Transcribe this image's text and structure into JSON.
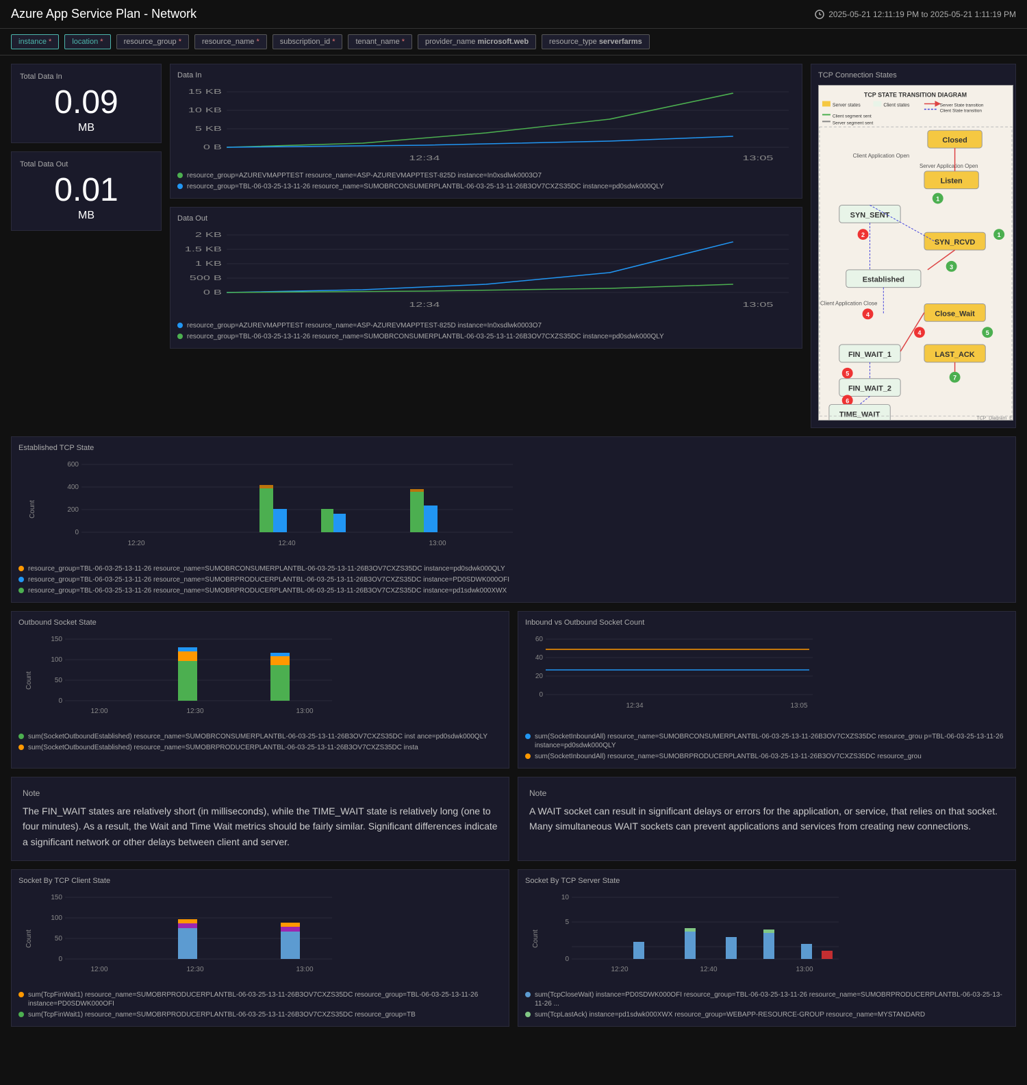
{
  "header": {
    "title": "Azure App Service Plan - Network",
    "time_range": "2025-05-21 12:11:19 PM to 2025-05-21 1:11:19 PM"
  },
  "filters": [
    {
      "id": "instance",
      "label": "instance",
      "required": true,
      "active": true
    },
    {
      "id": "location",
      "label": "location",
      "required": true,
      "active": true
    },
    {
      "id": "resource_group",
      "label": "resource_group",
      "required": true,
      "active": false
    },
    {
      "id": "resource_name",
      "label": "resource_name",
      "required": true,
      "active": false
    },
    {
      "id": "subscription_id",
      "label": "subscription_id",
      "required": true,
      "active": false
    },
    {
      "id": "tenant_name",
      "label": "tenant_name",
      "required": true,
      "active": false
    },
    {
      "id": "provider_name",
      "label": "provider_name microsoft.web",
      "required": false,
      "active": false
    },
    {
      "id": "resource_type",
      "label": "resource_type serverfarms",
      "required": false,
      "active": false
    }
  ],
  "metrics": {
    "total_data_in": {
      "label": "Total Data In",
      "value": "0.09",
      "unit": "MB"
    },
    "total_data_out": {
      "label": "Total Data Out",
      "value": "0.01",
      "unit": "MB"
    }
  },
  "charts": {
    "data_in": {
      "title": "Data In",
      "y_labels": [
        "15 KB",
        "10 KB",
        "5 KB",
        "0 B"
      ],
      "x_labels": [
        "12:34",
        "13:05"
      ],
      "legend": [
        {
          "color": "#4caf50",
          "text": "resource_group=AZUREVMAPPTEST resource_name=ASP-AZUREVMAPPTEST-825D instance=In0xsdlwk0003O7"
        },
        {
          "color": "#2196f3",
          "text": "resource_group=TBL-06-03-25-13-11-26 resource_name=SUMOBRCONSUMERPLANTBL-06-03-25-13-11-26B3OV7CXZS35DC instance=pd0sdwk000QLY"
        }
      ]
    },
    "data_out": {
      "title": "Data Out",
      "y_labels": [
        "2 KB",
        "1.5 KB",
        "1 KB",
        "500 B",
        "0 B"
      ],
      "x_labels": [
        "12:34",
        "13:05"
      ],
      "legend": [
        {
          "color": "#2196f3",
          "text": "resource_group=AZUREVMAPPTEST resource_name=ASP-AZUREVMAPPTEST-825D instance=In0xsdlwk0003O7"
        },
        {
          "color": "#4caf50",
          "text": "resource_group=TBL-06-03-25-13-11-26 resource_name=SUMOBRCONSUMERPLANTBL-06-03-25-13-11-26B3OV7CXZS35DC instance=pd0sdwk000QLY"
        }
      ]
    },
    "established_tcp": {
      "title": "Established TCP State",
      "y_labels": [
        "600",
        "400",
        "200",
        "0"
      ],
      "x_labels": [
        "12:20",
        "12:40",
        "13:00"
      ],
      "legend": [
        {
          "color": "#ff9800",
          "text": "resource_group=TBL-06-03-25-13-11-26 resource_name=SUMOBRCONSUMERPLANTBL-06-03-25-13-11-26B3OV7CXZS35DC instance=pd0sdwk000QLY"
        },
        {
          "color": "#2196f3",
          "text": "resource_group=TBL-06-03-25-13-11-26 resource_name=SUMOBRPRODUCERPLANTBL-06-03-25-13-11-26B3OV7CXZS35DC instance=PD0SDWK000OFI"
        },
        {
          "color": "#4caf50",
          "text": "resource_group=TBL-06-03-25-13-11-26 resource_name=SUMOBRPRODUCERPLANTBL-06-03-25-13-11-26B3OV7CXZS35DC instance=pd1sdwk000XWX"
        }
      ]
    },
    "outbound_socket": {
      "title": "Outbound Socket State",
      "y_labels": [
        "150",
        "100",
        "50",
        "0"
      ],
      "x_labels": [
        "12:00",
        "12:30",
        "13:00"
      ],
      "legend": [
        {
          "color": "#4caf50",
          "text": "sum(SocketOutboundEstablished) resource_name=SUMOBRCONSUMERPLANTBL-06-03-25-13-11-26B3OV7CXZS35DC inst ance=pd0sdwk000QLY"
        },
        {
          "color": "#ff9800",
          "text": "sum(SocketOutboundEstablished) resource_name=SUMOBRPRODUCERPLANTBL-06-03-25-13-11-26B3OV7CXZS35DC insta"
        }
      ]
    },
    "inbound_vs_outbound": {
      "title": "Inbound vs Outbound Socket Count",
      "y_labels": [
        "60",
        "40",
        "20",
        "0"
      ],
      "x_labels": [
        "12:34",
        "13:05"
      ],
      "legend": [
        {
          "color": "#2196f3",
          "text": "sum(SocketInboundAll) resource_name=SUMOBRCONSUMERPLANTBL-06-03-25-13-11-26B3OV7CXZS35DC resource_grou p=TBL-06-03-25-13-11-26 instance=pd0sdwk000QLY"
        },
        {
          "color": "#ff9800",
          "text": "sum(SocketInboundAll) resource_name=SUMOBRPRODUCERPLANTBL-06-03-25-13-11-26B3OV7CXZS35DC resource_grou"
        }
      ]
    }
  },
  "notes": {
    "left": {
      "title": "Note",
      "text": "The FIN_WAIT states are relatively short (in milliseconds), while the TIME_WAIT state is relatively long (one to four minutes). As a result, the Wait and Time Wait metrics should be fairly similar. Significant differences indicate a significant network or other delays between client and server."
    },
    "right": {
      "title": "Note",
      "text": "A WAIT socket can result in significant delays or errors for the application, or service, that relies on that socket. Many simultaneous WAIT sockets can prevent applications and services from creating new connections."
    }
  },
  "socket_charts": {
    "by_tcp_client": {
      "title": "Socket By TCP Client State",
      "y_labels": [
        "150",
        "100",
        "50",
        "0"
      ],
      "x_labels": [
        "12:00",
        "12:30",
        "13:00"
      ],
      "legend": [
        {
          "color": "#ff9800",
          "text": "sum(TcpFinWait1) resource_name=SUMOBRPRODUCERPLANTBL-06-03-25-13-11-26B3OV7CXZS35DC resource_group=TBL-06-03-25-13-11-26 instance=PD0SDWK000OFI"
        },
        {
          "color": "#4caf50",
          "text": "sum(TcpFinWait1) resource_name=SUMOBRPRODUCERPLANTBL-06-03-25-13-11-26B3OV7CXZS35DC resource_group=TB"
        }
      ]
    },
    "by_tcp_server": {
      "title": "Socket By TCP Server State",
      "y_labels": [
        "10",
        "5",
        "0"
      ],
      "x_labels": [
        "12:20",
        "12:40",
        "13:00"
      ],
      "legend": [
        {
          "color": "#5c9bd1",
          "text": "sum(TcpCloseWait) instance=PD0SDWK000OFI resource_group=TBL-06-03-25-13-11-26 resource_name=SUMOBRPRODUCERPLANTBL-06-03-25-13-11-26 ..."
        },
        {
          "color": "#81c784",
          "text": "sum(TcpLastAck) instance=pd1sdwk000XWX resource_group=WEBAPP-RESOURCE-GROUP resource_name=MYSTANDARD"
        }
      ]
    }
  },
  "tcp_diagram": {
    "title": "TCP Connection States",
    "diagram_title": "TCP STATE TRANSITION DIAGRAM"
  },
  "colors": {
    "background": "#111111",
    "card_bg": "#1a1a2a",
    "accent_green": "#4caf50",
    "accent_blue": "#2196f3",
    "accent_orange": "#ff9800",
    "text_primary": "#ffffff",
    "text_secondary": "#aaaaaa"
  }
}
